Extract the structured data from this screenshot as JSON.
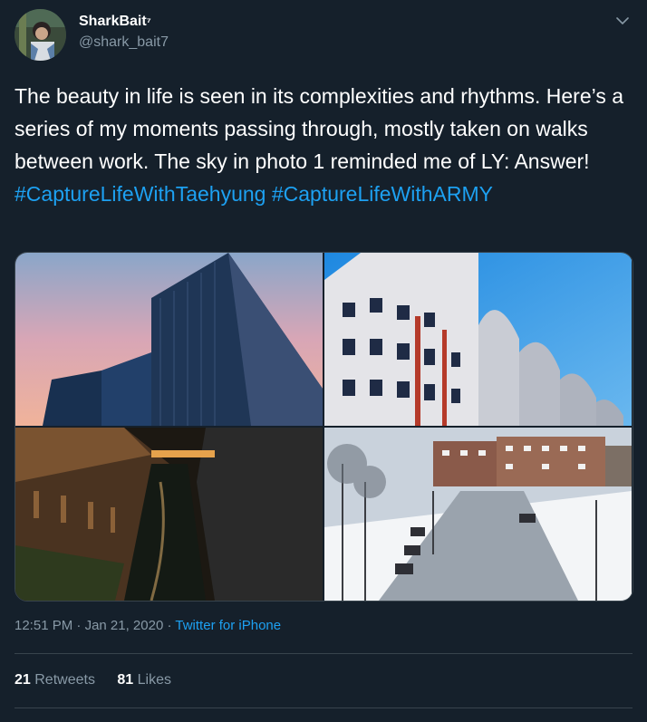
{
  "user": {
    "display_name": "SharkBait",
    "name_suffix": "⁷",
    "handle": "@shark_bait7"
  },
  "tweet": {
    "text_plain": "The beauty in life is seen in its complexities and rhythms. Here’s a series of my moments passing through, mostly taken on walks between work. The sky in photo 1 reminded me of LY: Answer!",
    "hashtags": [
      "#CaptureLifeWithTaehyung",
      "#CaptureLifeWithARMY"
    ],
    "photos": [
      "photo-1",
      "photo-2",
      "photo-3",
      "photo-4"
    ]
  },
  "meta": {
    "time": "12:51 PM",
    "separator": "·",
    "date": "Jan 21, 2020",
    "source": "Twitter for iPhone"
  },
  "stats": {
    "retweets_count": "21",
    "retweets_label": "Retweets",
    "likes_count": "81",
    "likes_label": "Likes"
  },
  "colors": {
    "background": "#15202b",
    "link": "#1da1f2",
    "muted": "#8899a6",
    "divider": "#38444d"
  },
  "icons": {
    "caret": "chevron-down-icon"
  }
}
